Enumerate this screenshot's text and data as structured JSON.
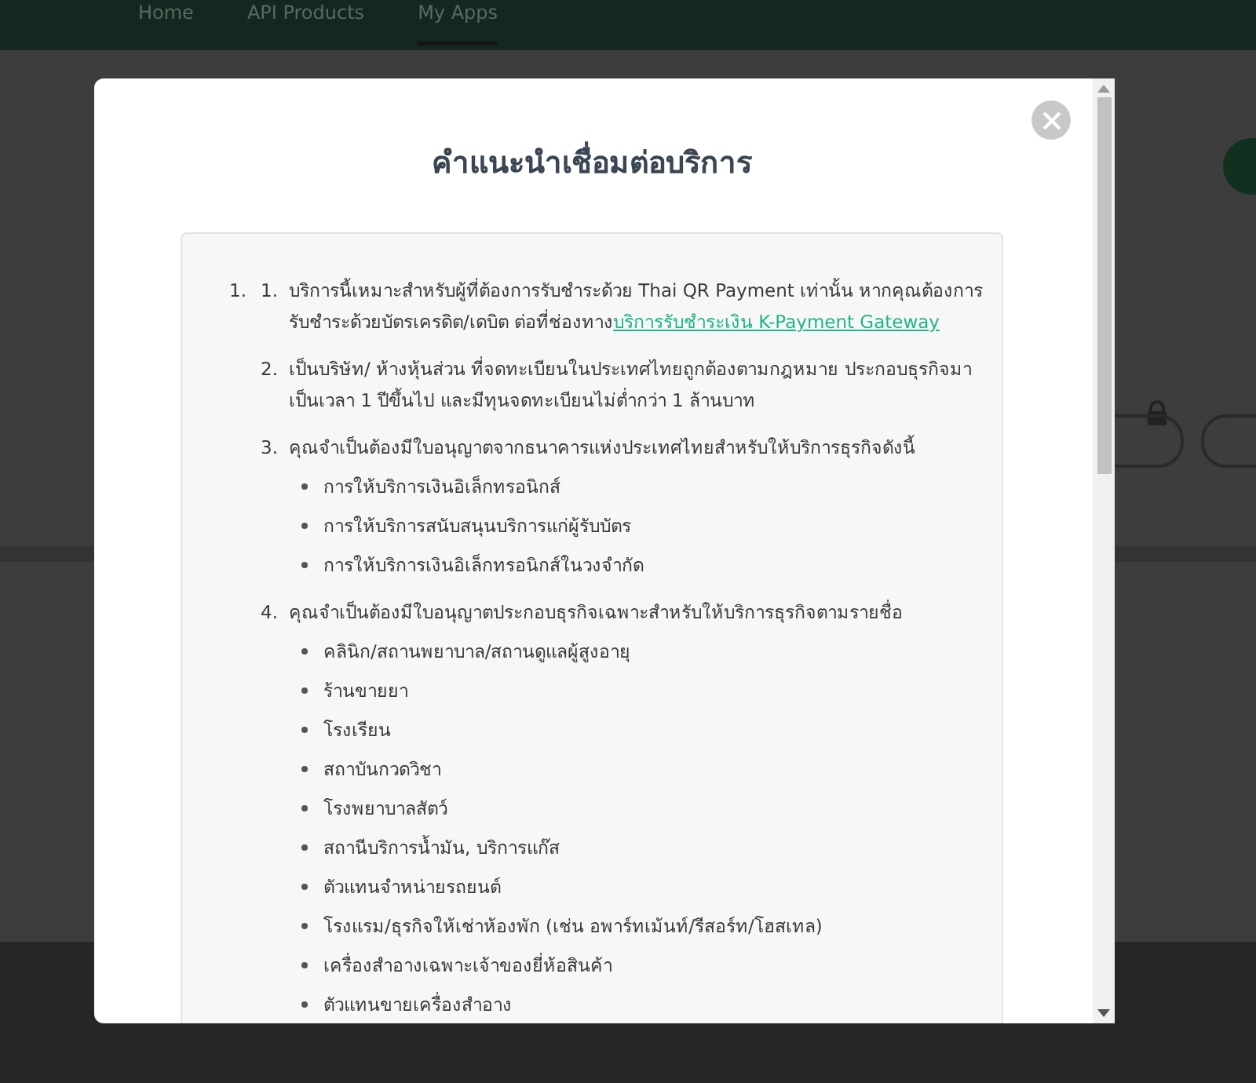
{
  "nav": {
    "tabs": [
      {
        "label": "Home",
        "selected": false
      },
      {
        "label": "API Products",
        "selected": false
      },
      {
        "label": "My Apps",
        "selected": true
      }
    ]
  },
  "modal": {
    "title": "คำแนะนำเชื่อมต่อบริการ",
    "outer_number": "1.",
    "items": [
      {
        "number": "1.",
        "text": "บริการนี้เหมาะสำหรับผู้ที่ต้องการรับชำระด้วย Thai QR Payment เท่านั้น หากคุณต้องการรับชำระด้วยบัตรเครดิต/เดบิต ต่อที่ช่องทาง",
        "link": "บริการรับชำระเงิน K-Payment Gateway"
      },
      {
        "number": "2.",
        "text": "เป็นบริษัท/ ห้างหุ้นส่วน ที่จดทะเบียนในประเทศไทยถูกต้องตามกฎหมาย ประกอบธุรกิจมาเป็นเวลา 1 ปีขึ้นไป และมีทุนจดทะเบียนไม่ต่ำกว่า 1 ล้านบาท"
      },
      {
        "number": "3.",
        "text": "คุณจำเป็นต้องมีใบอนุญาตจากธนาคารแห่งประเทศไทยสำหรับให้บริการธุรกิจดังนี้",
        "bullets": [
          "การให้บริการเงินอิเล็กทรอนิกส์",
          "การให้บริการสนับสนุนบริการแก่ผู้รับบัตร",
          "การให้บริการเงินอิเล็กทรอนิกส์ในวงจำกัด"
        ]
      },
      {
        "number": "4.",
        "text": "คุณจำเป็นต้องมีใบอนุญาตประกอบธุรกิจเฉพาะสำหรับให้บริการธุรกิจตามรายชื่อ",
        "bullets": [
          "คลินิก/สถานพยาบาล/สถานดูแลผู้สูงอายุ",
          "ร้านขายยา",
          "โรงเรียน",
          "สถาบันกวดวิชา",
          "โรงพยาบาลสัตว์",
          "สถานีบริการน้ำมัน, บริการแก๊ส",
          "ตัวแทนจำหน่ายรถยนต์",
          "โรงแรม/ธุรกิจให้เช่าห้องพัก (เช่น อพาร์ทเม้นท์/รีสอร์ท/โฮสเทล)",
          "เครื่องสำอางเฉพาะเจ้าของยี่ห้อสินค้า",
          "ตัวแทนขายเครื่องสำอาง"
        ]
      }
    ]
  }
}
